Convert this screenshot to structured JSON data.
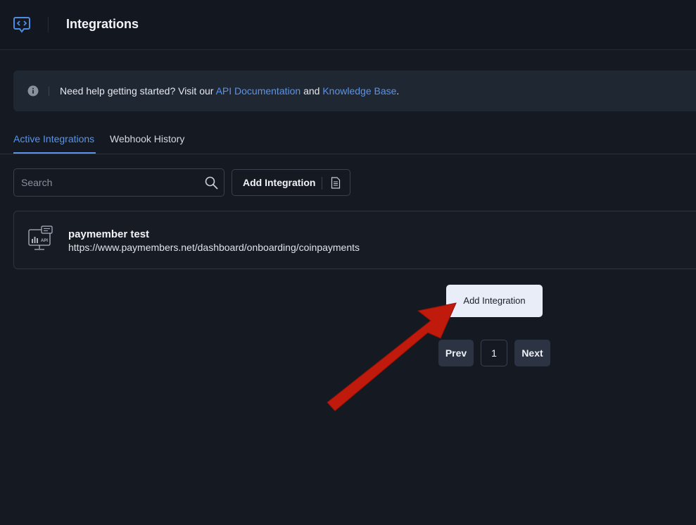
{
  "header": {
    "title": "Integrations",
    "logo_icon": "chat-code-icon"
  },
  "info_banner": {
    "icon": "info-icon",
    "text_before": "Need help getting started? Visit our ",
    "link_api": "API Documentation",
    "text_and": " and ",
    "link_kb": "Knowledge Base",
    "text_after": "."
  },
  "tabs": [
    {
      "label": "Active Integrations",
      "active": true
    },
    {
      "label": "Webhook History",
      "active": false
    }
  ],
  "search": {
    "placeholder": "Search",
    "value": ""
  },
  "toolbar": {
    "add_label": "Add Integration",
    "doc_icon": "document-icon"
  },
  "integrations": [
    {
      "name": "paymember test",
      "url": "https://www.paymembers.net/dashboard/onboarding/coinpayments",
      "icon": "api-monitor-icon"
    }
  ],
  "add_button": {
    "label": "Add Integration"
  },
  "pagination": {
    "prev_label": "Prev",
    "current_page": "1",
    "next_label": "Next"
  },
  "colors": {
    "background": "#141922",
    "accent": "#5b93e6",
    "annotation_arrow": "#c0190b"
  }
}
